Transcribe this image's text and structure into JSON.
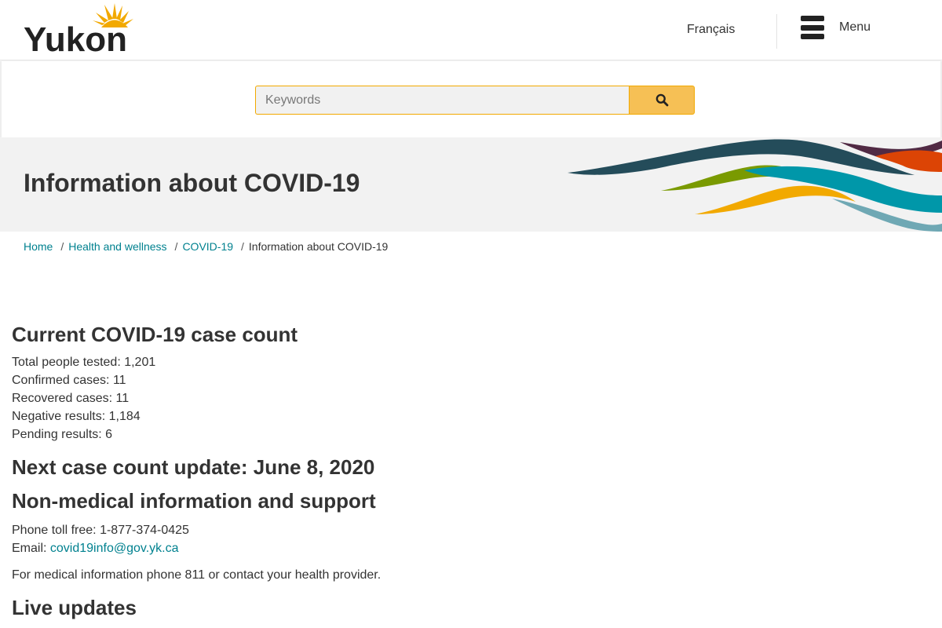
{
  "header": {
    "logo_text": "Yukon",
    "language_link": "Français",
    "menu_label": "Menu"
  },
  "search": {
    "placeholder": "Keywords",
    "button_icon": "search-icon"
  },
  "hero": {
    "title": "Information about COVID-19"
  },
  "breadcrumb": {
    "items": [
      "Home",
      "Health and wellness",
      "COVID-19"
    ],
    "separator": "/",
    "current": "Information about COVID-19"
  },
  "main": {
    "case_count_heading": "Current COVID-19 case count",
    "case_lines": [
      "Total people tested: 1,201",
      "Confirmed cases: 11",
      "Recovered cases: 11",
      "Negative results: 1,184",
      "Pending results: 6"
    ],
    "next_update_heading": "Next case count update: June 8, 2020",
    "nonmedical_heading": "Non-medical information and support",
    "phone_line": "Phone toll free: 1-877-374-0425",
    "email_label": "Email:",
    "email_link": "covid19info@gov.yk.ca",
    "medical_line": "For medical information phone 811 or contact your health provider.",
    "live_updates_heading": "Live updates"
  },
  "colors": {
    "link": "#00818f",
    "search_button": "#f6c055",
    "search_border": "#f2a900",
    "hero_background": "#f2f2f2",
    "wave_dark_teal": "#244c5a",
    "wave_green": "#7a9a01",
    "wave_gold": "#f2a900",
    "wave_teal": "#0097a9",
    "wave_light_teal": "#6fa8b4",
    "wave_purple": "#512a44",
    "wave_orange": "#dc4405"
  }
}
